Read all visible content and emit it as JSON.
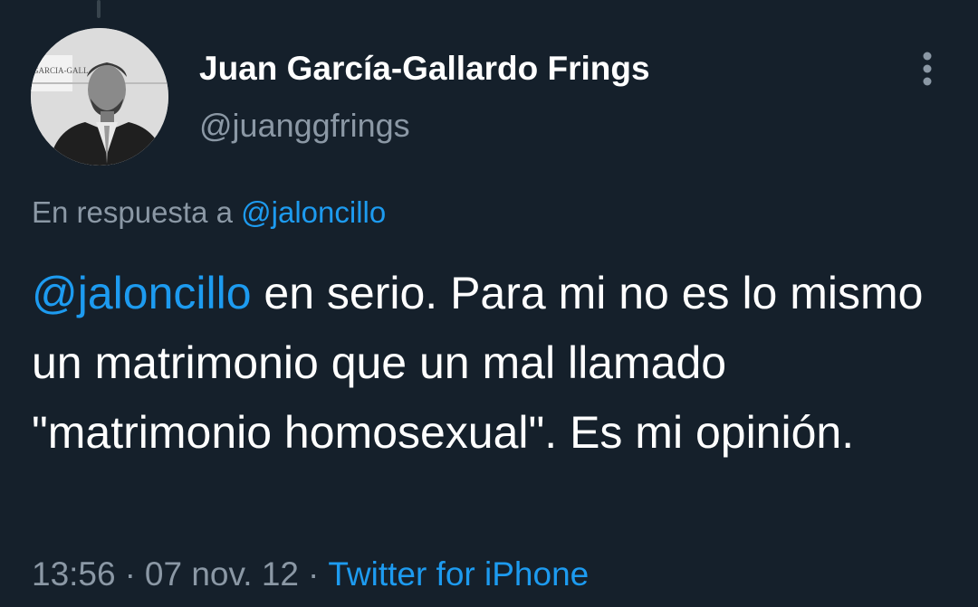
{
  "tweet": {
    "author": {
      "display_name": "Juan García-Gallardo Frings",
      "handle": "@juanggfrings",
      "avatar_sign_text": "GARCIA-GALL"
    },
    "reply_to": {
      "prefix": "En respuesta a",
      "mention": "@jaloncillo"
    },
    "body": {
      "mention": "@jaloncillo",
      "text": " en serio. Para mi no es lo mismo un matrimonio que un mal llamado \"matrimonio homosexual\". Es mi opinión."
    },
    "meta": {
      "time": "13:56",
      "separator": "·",
      "date": "07 nov. 12",
      "source": "Twitter for iPhone"
    },
    "icons": {
      "more": "more-vertical-icon"
    },
    "colors": {
      "background": "#15202b",
      "link": "#1d9bf0",
      "secondary_text": "#8b98a5",
      "primary_text": "#ffffff"
    }
  }
}
